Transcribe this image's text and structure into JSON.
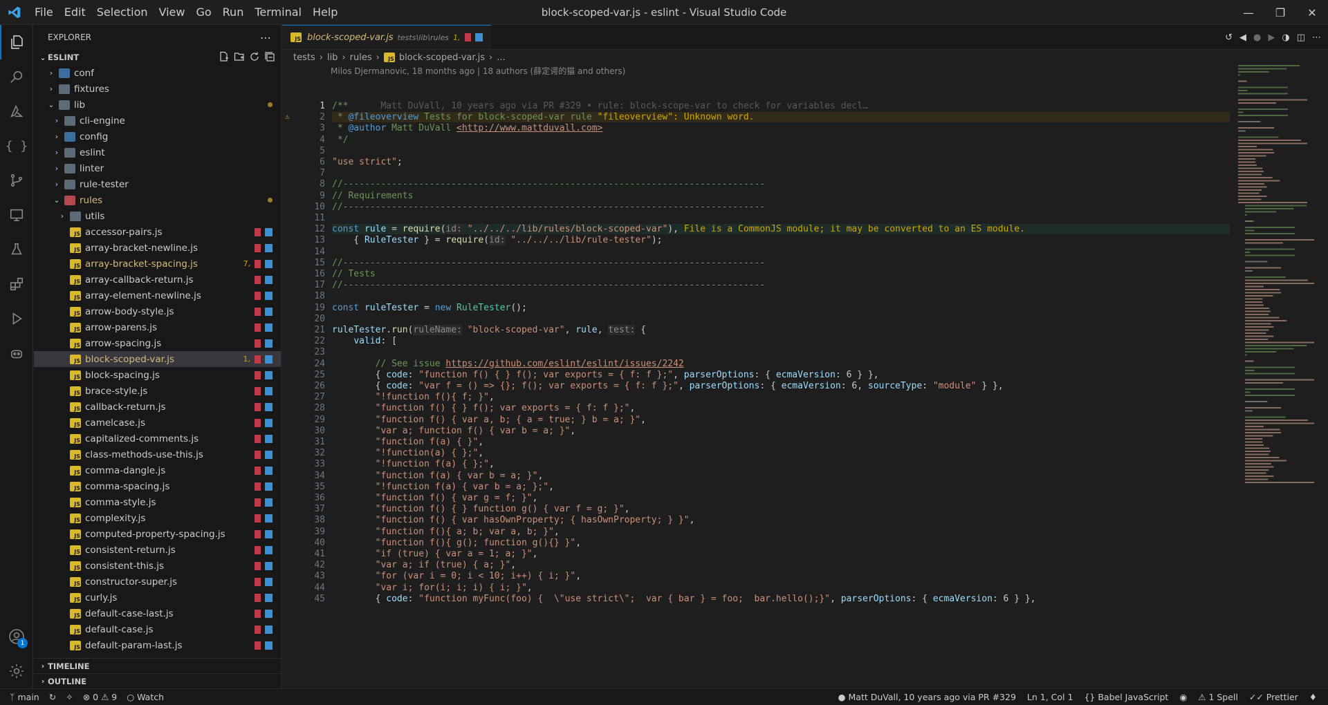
{
  "window": {
    "title": "block-scoped-var.js - eslint - Visual Studio Code"
  },
  "menu": [
    "File",
    "Edit",
    "Selection",
    "View",
    "Go",
    "Run",
    "Terminal",
    "Help"
  ],
  "activity": {
    "accounts_badge": "1"
  },
  "sidebar": {
    "header": "EXPLORER",
    "project": "ESLINT",
    "tree": [
      {
        "label": "conf",
        "depth": 1,
        "type": "folder-special",
        "expanded": false
      },
      {
        "label": "fixtures",
        "depth": 1,
        "type": "folder",
        "expanded": false
      },
      {
        "label": "lib",
        "depth": 1,
        "type": "folder",
        "expanded": true,
        "modified": true
      },
      {
        "label": "cli-engine",
        "depth": 2,
        "type": "folder",
        "expanded": false
      },
      {
        "label": "config",
        "depth": 2,
        "type": "folder-special",
        "expanded": false
      },
      {
        "label": "eslint",
        "depth": 2,
        "type": "folder",
        "expanded": false
      },
      {
        "label": "linter",
        "depth": 2,
        "type": "folder",
        "expanded": false
      },
      {
        "label": "rule-tester",
        "depth": 2,
        "type": "folder",
        "expanded": false
      },
      {
        "label": "rules",
        "depth": 2,
        "type": "folder-red",
        "expanded": true,
        "modified": true
      },
      {
        "label": "utils",
        "depth": 3,
        "type": "folder",
        "expanded": false
      },
      {
        "label": "accessor-pairs.js",
        "depth": 3,
        "type": "js"
      },
      {
        "label": "array-bracket-newline.js",
        "depth": 3,
        "type": "js"
      },
      {
        "label": "array-bracket-spacing.js",
        "depth": 3,
        "type": "js",
        "count": "7,",
        "warn": true
      },
      {
        "label": "array-callback-return.js",
        "depth": 3,
        "type": "js"
      },
      {
        "label": "array-element-newline.js",
        "depth": 3,
        "type": "js"
      },
      {
        "label": "arrow-body-style.js",
        "depth": 3,
        "type": "js"
      },
      {
        "label": "arrow-parens.js",
        "depth": 3,
        "type": "js"
      },
      {
        "label": "arrow-spacing.js",
        "depth": 3,
        "type": "js"
      },
      {
        "label": "block-scoped-var.js",
        "depth": 3,
        "type": "js",
        "count": "1,",
        "warn": true,
        "selected": true
      },
      {
        "label": "block-spacing.js",
        "depth": 3,
        "type": "js"
      },
      {
        "label": "brace-style.js",
        "depth": 3,
        "type": "js"
      },
      {
        "label": "callback-return.js",
        "depth": 3,
        "type": "js"
      },
      {
        "label": "camelcase.js",
        "depth": 3,
        "type": "js"
      },
      {
        "label": "capitalized-comments.js",
        "depth": 3,
        "type": "js"
      },
      {
        "label": "class-methods-use-this.js",
        "depth": 3,
        "type": "js"
      },
      {
        "label": "comma-dangle.js",
        "depth": 3,
        "type": "js"
      },
      {
        "label": "comma-spacing.js",
        "depth": 3,
        "type": "js"
      },
      {
        "label": "comma-style.js",
        "depth": 3,
        "type": "js"
      },
      {
        "label": "complexity.js",
        "depth": 3,
        "type": "js"
      },
      {
        "label": "computed-property-spacing.js",
        "depth": 3,
        "type": "js"
      },
      {
        "label": "consistent-return.js",
        "depth": 3,
        "type": "js"
      },
      {
        "label": "consistent-this.js",
        "depth": 3,
        "type": "js"
      },
      {
        "label": "constructor-super.js",
        "depth": 3,
        "type": "js"
      },
      {
        "label": "curly.js",
        "depth": 3,
        "type": "js"
      },
      {
        "label": "default-case-last.js",
        "depth": 3,
        "type": "js"
      },
      {
        "label": "default-case.js",
        "depth": 3,
        "type": "js"
      },
      {
        "label": "default-param-last.js",
        "depth": 3,
        "type": "js"
      }
    ],
    "timeline": "TIMELINE",
    "outline": "OUTLINE"
  },
  "tab": {
    "name": "block-scoped-var.js",
    "path": "tests\\lib\\rules",
    "count": "1,"
  },
  "breadcrumb": [
    "tests",
    "lib",
    "rules",
    "block-scoped-var.js",
    "..."
  ],
  "blame_header": "Milos Djermanovic, 18 months ago | 18 authors (薛定谔的猫 and others)",
  "code_lines": [
    [
      [
        "c-com",
        "/**"
      ],
      [
        "c-ghost",
        "      Matt DuVall, 10 years ago via PR #329 • rule: block-scope-var to check for variables decl…"
      ]
    ],
    [
      [
        "c-com",
        " * "
      ],
      [
        "c-kw",
        "@fileoverview"
      ],
      [
        "c-com",
        " Tests for block-scoped-var rule "
      ],
      [
        "c-warn",
        "\"fileoverview\": Unknown word."
      ]
    ],
    [
      [
        "c-com",
        " * "
      ],
      [
        "c-kw",
        "@author"
      ],
      [
        "c-com",
        " Matt DuVall "
      ],
      [
        "c-link",
        "<http://www.mattduvall.com>"
      ]
    ],
    [
      [
        "c-com",
        " */"
      ]
    ],
    [],
    [
      [
        "c-str",
        "\"use strict\""
      ],
      [
        "",
        "; "
      ]
    ],
    [],
    [
      [
        "c-com",
        "//------------------------------------------------------------------------------"
      ]
    ],
    [
      [
        "c-com",
        "// Requirements"
      ]
    ],
    [
      [
        "c-com",
        "//------------------------------------------------------------------------------"
      ]
    ],
    [],
    [
      [
        "c-kw",
        "const "
      ],
      [
        "c-var",
        "rule"
      ],
      [
        "",
        " = "
      ],
      [
        "c-fn",
        "require"
      ],
      [
        "",
        "("
      ],
      [
        "c-hint",
        "id:"
      ],
      [
        "c-str",
        " \"../../../lib/rules/block-scoped-var\""
      ],
      [
        "",
        "), "
      ],
      [
        "c-warn",
        "File is a CommonJS module; it may be converted to an ES module."
      ]
    ],
    [
      [
        "",
        "    { "
      ],
      [
        "c-var",
        "RuleTester"
      ],
      [
        "",
        " } = "
      ],
      [
        "c-fn",
        "require"
      ],
      [
        "",
        "("
      ],
      [
        "c-hint",
        "id:"
      ],
      [
        "c-str",
        " \"../../../lib/rule-tester\""
      ],
      [
        "",
        ");"
      ]
    ],
    [],
    [
      [
        "c-com",
        "//------------------------------------------------------------------------------"
      ]
    ],
    [
      [
        "c-com",
        "// Tests"
      ]
    ],
    [
      [
        "c-com",
        "//------------------------------------------------------------------------------"
      ]
    ],
    [],
    [
      [
        "c-kw",
        "const "
      ],
      [
        "c-var",
        "ruleTester"
      ],
      [
        "",
        " = "
      ],
      [
        "c-kw",
        "new "
      ],
      [
        "c-cls",
        "RuleTester"
      ],
      [
        "",
        "();"
      ]
    ],
    [],
    [
      [
        "c-var",
        "ruleTester"
      ],
      [
        "",
        "."
      ],
      [
        "c-fn",
        "run"
      ],
      [
        "",
        "("
      ],
      [
        "c-hint",
        "ruleName:"
      ],
      [
        "c-str",
        " \"block-scoped-var\""
      ],
      [
        "",
        ", "
      ],
      [
        "c-var",
        "rule"
      ],
      [
        "",
        ", "
      ],
      [
        "c-hint",
        "test:"
      ],
      [
        "",
        " {"
      ]
    ],
    [
      [
        "",
        "    "
      ],
      [
        "c-var",
        "valid"
      ],
      [
        "",
        ": ["
      ]
    ],
    [],
    [
      [
        "",
        "        "
      ],
      [
        "c-com",
        "// See issue "
      ],
      [
        "c-link",
        "https://github.com/eslint/eslint/issues/2242"
      ]
    ],
    [
      [
        "",
        "        { "
      ],
      [
        "c-var",
        "code"
      ],
      [
        "",
        ": "
      ],
      [
        "c-str",
        "\"function f() { } f(); var exports = { f: f };\""
      ],
      [
        "",
        ", "
      ],
      [
        "c-var",
        "parserOptions"
      ],
      [
        "",
        ": { "
      ],
      [
        "c-var",
        "ecmaVersion"
      ],
      [
        "",
        ": 6 } },"
      ]
    ],
    [
      [
        "",
        "        { "
      ],
      [
        "c-var",
        "code"
      ],
      [
        "",
        ": "
      ],
      [
        "c-str",
        "\"var f = () => {}; f(); var exports = { f: f };\""
      ],
      [
        "",
        ", "
      ],
      [
        "c-var",
        "parserOptions"
      ],
      [
        "",
        ": { "
      ],
      [
        "c-var",
        "ecmaVersion"
      ],
      [
        "",
        ": 6, "
      ],
      [
        "c-var",
        "sourceType"
      ],
      [
        "",
        ": "
      ],
      [
        "c-str",
        "\"module\""
      ],
      [
        "",
        " } },"
      ]
    ],
    [
      [
        "",
        "        "
      ],
      [
        "c-str",
        "\"!function f(){ f; }\""
      ],
      [
        "",
        ","
      ]
    ],
    [
      [
        "",
        "        "
      ],
      [
        "c-str",
        "\"function f() { } f(); var exports = { f: f };\""
      ],
      [
        "",
        ","
      ]
    ],
    [
      [
        "",
        "        "
      ],
      [
        "c-str",
        "\"function f() { var a, b; { a = true; } b = a; }\""
      ],
      [
        "",
        ","
      ]
    ],
    [
      [
        "",
        "        "
      ],
      [
        "c-str",
        "\"var a; function f() { var b = a; }\""
      ],
      [
        "",
        ","
      ]
    ],
    [
      [
        "",
        "        "
      ],
      [
        "c-str",
        "\"function f(a) { }\""
      ],
      [
        "",
        ","
      ]
    ],
    [
      [
        "",
        "        "
      ],
      [
        "c-str",
        "\"!function(a) { };\""
      ],
      [
        "",
        ","
      ]
    ],
    [
      [
        "",
        "        "
      ],
      [
        "c-str",
        "\"!function f(a) { };\""
      ],
      [
        "",
        ","
      ]
    ],
    [
      [
        "",
        "        "
      ],
      [
        "c-str",
        "\"function f(a) { var b = a; }\""
      ],
      [
        "",
        ","
      ]
    ],
    [
      [
        "",
        "        "
      ],
      [
        "c-str",
        "\"!function f(a) { var b = a; };\""
      ],
      [
        "",
        ","
      ]
    ],
    [
      [
        "",
        "        "
      ],
      [
        "c-str",
        "\"function f() { var g = f; }\""
      ],
      [
        "",
        ","
      ]
    ],
    [
      [
        "",
        "        "
      ],
      [
        "c-str",
        "\"function f() { } function g() { var f = g; }\""
      ],
      [
        "",
        ","
      ]
    ],
    [
      [
        "",
        "        "
      ],
      [
        "c-str",
        "\"function f() { var hasOwnProperty; { hasOwnProperty; } }\""
      ],
      [
        "",
        ","
      ]
    ],
    [
      [
        "",
        "        "
      ],
      [
        "c-str",
        "\"function f(){ a; b; var a, b; }\""
      ],
      [
        "",
        ","
      ]
    ],
    [
      [
        "",
        "        "
      ],
      [
        "c-str",
        "\"function f(){ g(); function g(){} }\""
      ],
      [
        "",
        ","
      ]
    ],
    [
      [
        "",
        "        "
      ],
      [
        "c-str",
        "\"if (true) { var a = 1; a; }\""
      ],
      [
        "",
        ","
      ]
    ],
    [
      [
        "",
        "        "
      ],
      [
        "c-str",
        "\"var a; if (true) { a; }\""
      ],
      [
        "",
        ","
      ]
    ],
    [
      [
        "",
        "        "
      ],
      [
        "c-str",
        "\"for (var i = 0; i < 10; i++) { i; }\""
      ],
      [
        "",
        ","
      ]
    ],
    [
      [
        "",
        "        "
      ],
      [
        "c-str",
        "\"var i; for(i; i; i) { i; }\""
      ],
      [
        "",
        ","
      ]
    ],
    [
      [
        "",
        "        { "
      ],
      [
        "c-var",
        "code"
      ],
      [
        "",
        ": "
      ],
      [
        "c-str",
        "\"function myFunc(foo) {  \\\"use strict\\\";  var { bar } = foo;  bar.hello();}\""
      ],
      [
        "",
        ", "
      ],
      [
        "c-var",
        "parserOptions"
      ],
      [
        "",
        ": { "
      ],
      [
        "c-var",
        "ecmaVersion"
      ],
      [
        "",
        ": 6 } },"
      ]
    ]
  ],
  "status": {
    "branch": "main",
    "errors": "0",
    "warnings": "9",
    "watch": "Watch",
    "blame": "Matt DuVall, 10 years ago via PR #329",
    "position": "Ln 1, Col 1",
    "language": "Babel JavaScript",
    "spell": "1 Spell",
    "prettier": "Prettier"
  },
  "colors": {
    "accent": "#0078d4",
    "js_icon": "#d9b92a",
    "warn": "#cca700"
  }
}
